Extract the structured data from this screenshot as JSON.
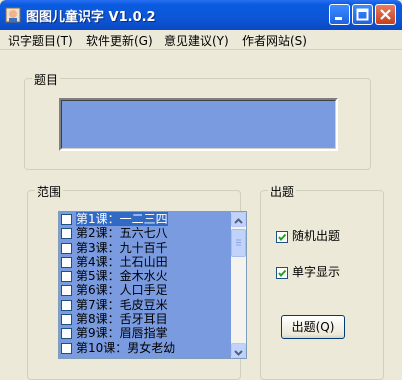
{
  "window": {
    "title": "图图儿童识字 V1.0.2"
  },
  "menu": {
    "items": [
      "识字题目(T)",
      "软件更新(G)",
      "意见建议(Y)",
      "作者网站(S)"
    ]
  },
  "question_group": {
    "title": "题目"
  },
  "range_group": {
    "title": "范围",
    "items": [
      "第1课：一二三四",
      "第2课：五六七八",
      "第3课：九十百千",
      "第4课：土石山田",
      "第5课：金木水火",
      "第6课：人口手足",
      "第7课：毛皮豆米",
      "第8课：舌牙耳目",
      "第9课：眉唇指掌",
      "第10课：男女老幼"
    ],
    "selected_index": 0
  },
  "options_group": {
    "title": "出题",
    "random_label": "随机出题",
    "random_checked": true,
    "single_label": "单字显示",
    "single_checked": true,
    "question_button": "出题(Q)"
  }
}
